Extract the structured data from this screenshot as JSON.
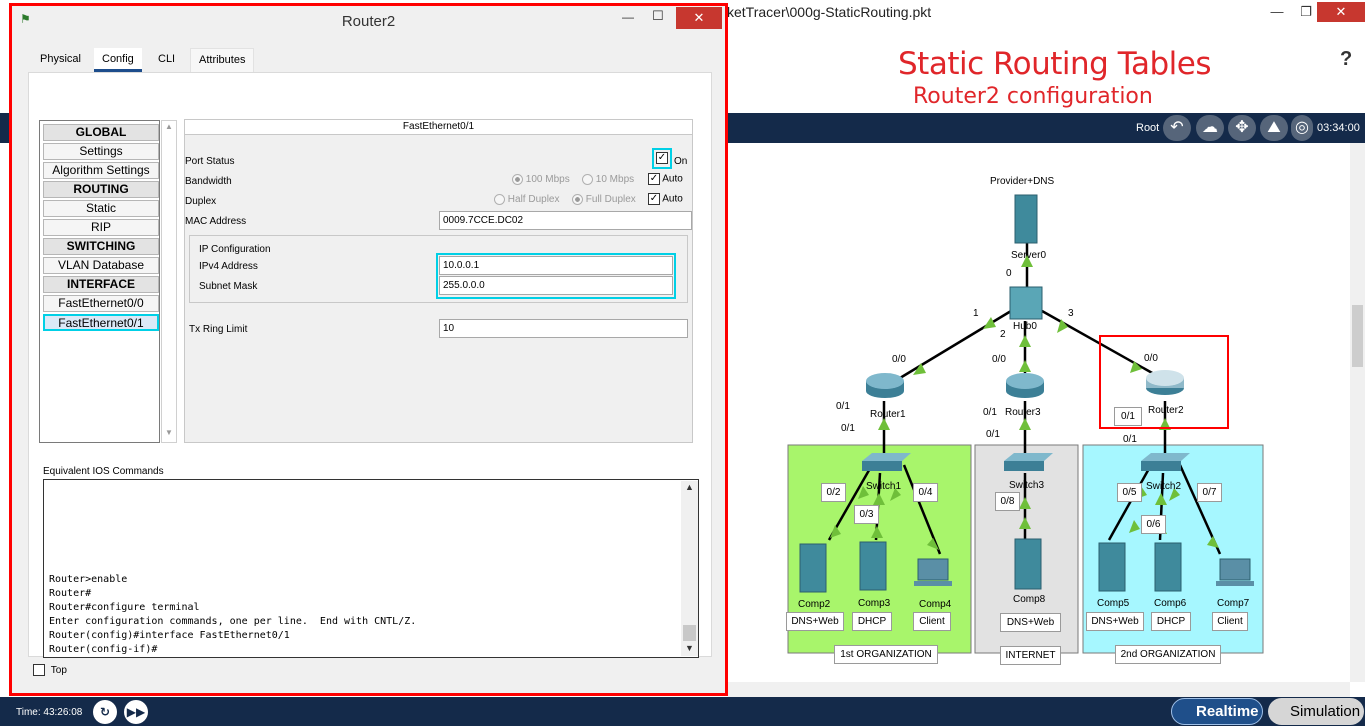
{
  "main_window": {
    "title": "ketTracer\\000g-StaticRouting.pkt",
    "lesson_title": "Static Routing Tables",
    "lesson_subtitle": "Router2 configuration",
    "help_symbol": "?",
    "root_label": "Root",
    "clock": "03:34:00",
    "time_label": "Time: 43:26:08",
    "realtime_label": "Realtime",
    "simulation_label": "Simulation"
  },
  "dialog": {
    "title": "Router2",
    "tabs": [
      "Physical",
      "Config",
      "CLI",
      "Attributes"
    ],
    "active_tab": "Config",
    "nav": [
      {
        "label": "GLOBAL",
        "type": "header"
      },
      {
        "label": "Settings",
        "type": "item"
      },
      {
        "label": "Algorithm Settings",
        "type": "item"
      },
      {
        "label": "ROUTING",
        "type": "header"
      },
      {
        "label": "Static",
        "type": "item"
      },
      {
        "label": "RIP",
        "type": "item"
      },
      {
        "label": "SWITCHING",
        "type": "header"
      },
      {
        "label": "VLAN Database",
        "type": "item"
      },
      {
        "label": "INTERFACE",
        "type": "header"
      },
      {
        "label": "FastEthernet0/0",
        "type": "item"
      },
      {
        "label": "FastEthernet0/1",
        "type": "selected"
      }
    ],
    "interface": {
      "header": "FastEthernet0/1",
      "port_status_label": "Port Status",
      "port_status_on_label": "On",
      "port_status_on": true,
      "bandwidth_label": "Bandwidth",
      "bandwidth_100": "100 Mbps",
      "bandwidth_10": "10 Mbps",
      "bandwidth_auto": "Auto",
      "duplex_label": "Duplex",
      "duplex_half": "Half Duplex",
      "duplex_full": "Full Duplex",
      "duplex_auto": "Auto",
      "mac_label": "MAC Address",
      "mac_value": "0009.7CCE.DC02",
      "ip_group_label": "IP Configuration",
      "ipv4_label": "IPv4 Address",
      "ipv4_value": "10.0.0.1",
      "mask_label": "Subnet Mask",
      "mask_value": "255.0.0.0",
      "tx_label": "Tx Ring Limit",
      "tx_value": "10"
    },
    "ios_label": "Equivalent IOS Commands",
    "ios_lines": "Router>enable\nRouter#\nRouter#configure terminal\nEnter configuration commands, one per line.  End with CNTL/Z.\nRouter(config)#interface FastEthernet0/1\nRouter(config-if)#",
    "top_label": "Top"
  },
  "topology": {
    "provider_label": "Provider+DNS",
    "server0": "Server0",
    "hub0": "Hub0",
    "router1": "Router1",
    "router2": "Router2",
    "router3": "Router3",
    "switch1": "Switch1",
    "switch2": "Switch2",
    "switch3": "Switch3",
    "ports": {
      "server0_0": "0",
      "hub_1": "1",
      "hub_2": "2",
      "hub_3": "3",
      "r1_00": "0/0",
      "r1_01a": "0/1",
      "r1_01b": "0/1",
      "r3_00": "0/0",
      "r3_01a": "0/1",
      "r3_01b": "0/1",
      "r2_00": "0/0",
      "r2_01a": "0/1",
      "r2_01b": "0/1",
      "s1_02": "0/2",
      "s1_03": "0/3",
      "s1_04": "0/4",
      "s3_08": "0/8",
      "s2_05": "0/5",
      "s2_06": "0/6",
      "s2_07": "0/7"
    },
    "pcs": [
      {
        "name": "Comp2",
        "tag": "DNS+Web"
      },
      {
        "name": "Comp3",
        "tag": "DHCP"
      },
      {
        "name": "Comp4",
        "tag": "Client"
      },
      {
        "name": "Comp8",
        "tag": "DNS+Web"
      },
      {
        "name": "Comp5",
        "tag": "DNS+Web"
      },
      {
        "name": "Comp6",
        "tag": "DHCP"
      },
      {
        "name": "Comp7",
        "tag": "Client"
      }
    ],
    "org1": "1st ORGANIZATION",
    "internet": "INTERNET",
    "org2": "2nd ORGANIZATION",
    "colors": {
      "org1_bg": "#a8f56b",
      "internet_bg": "#e2e2e2",
      "org2_bg": "#a6f7ff",
      "link_arrow": "#6fbf3a",
      "highlight": "#00d0e6",
      "red_outline": "#ff0000"
    }
  }
}
